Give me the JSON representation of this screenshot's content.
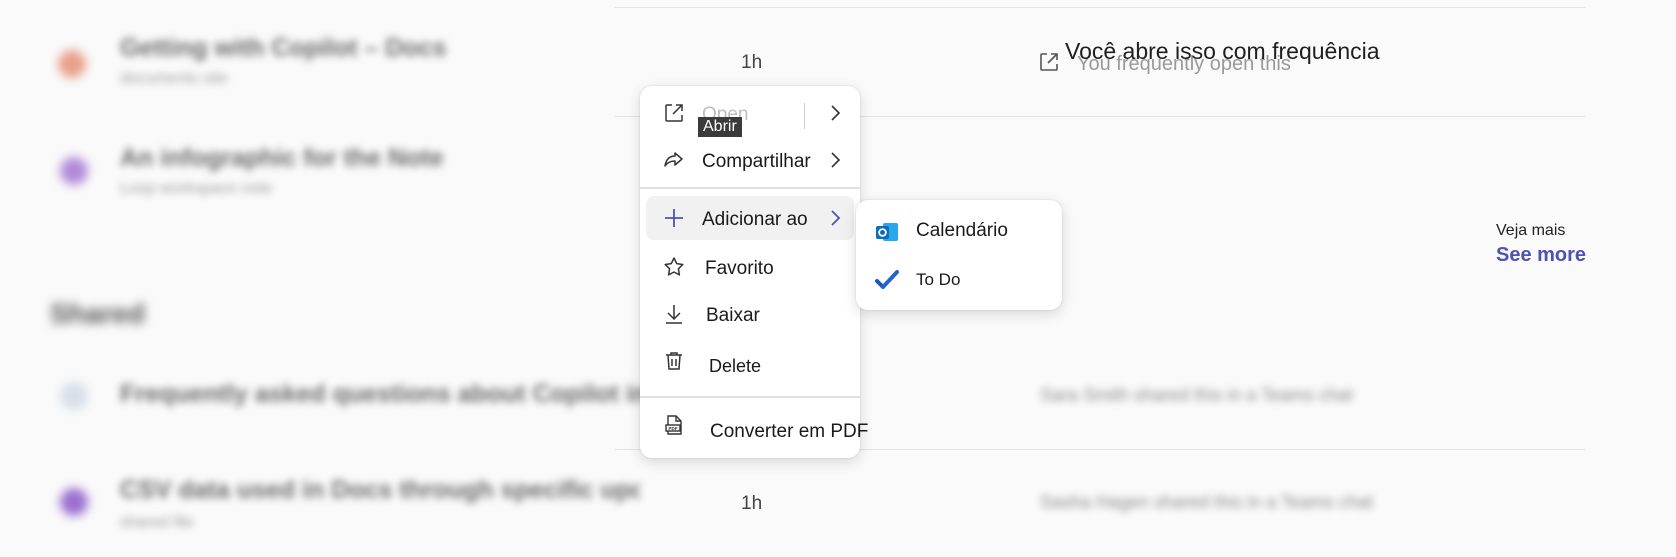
{
  "recent_rows": [
    {
      "title": "Getting with Copilot – Docs",
      "subtitle": "documents site",
      "time": "1h"
    },
    {
      "title": "An infographic for the Note",
      "subtitle": "Loop workspace note"
    }
  ],
  "section": {
    "title": "Shared"
  },
  "shared_rows": [
    {
      "title": "Frequently asked questions about Copilot in Word",
      "meta": "Sara Smith shared this in a Teams chat"
    },
    {
      "title": "CSV data used in Docs through specific updates…",
      "subtitle": "shared file",
      "time": "1h",
      "meta": "Sasha Hagen shared this in a Teams chat"
    }
  ],
  "activity": {
    "text_pt": "Você abre isso com frequência",
    "text_en": "You frequently open this",
    "icon": "open-external-icon"
  },
  "see_more": {
    "label_pt": "Veja mais",
    "label_en": "See more"
  },
  "context_menu": {
    "open": {
      "label": "Open",
      "tooltip": "Abrir",
      "icon": "open-external-icon"
    },
    "share": {
      "label": "Compartilhar",
      "icon": "share-icon"
    },
    "add_to": {
      "label": "Adicionar ao",
      "icon": "plus-icon"
    },
    "favorite": {
      "label": "Favorito",
      "icon": "star-icon"
    },
    "download": {
      "label": "Baixar",
      "icon": "download-icon"
    },
    "delete": {
      "label": "Delete",
      "icon": "trash-icon"
    },
    "convert": {
      "label": "Converter em PDF",
      "icon": "pdf-file-icon"
    }
  },
  "submenu": {
    "calendar": {
      "label": "Calendário",
      "icon": "outlook-icon"
    },
    "todo": {
      "label": "To Do",
      "icon": "todo-check-icon"
    }
  },
  "colors": {
    "accent": "#4f52b2",
    "outlook_blue": "#0f6cbd",
    "todo_blue": "#2564cf"
  }
}
